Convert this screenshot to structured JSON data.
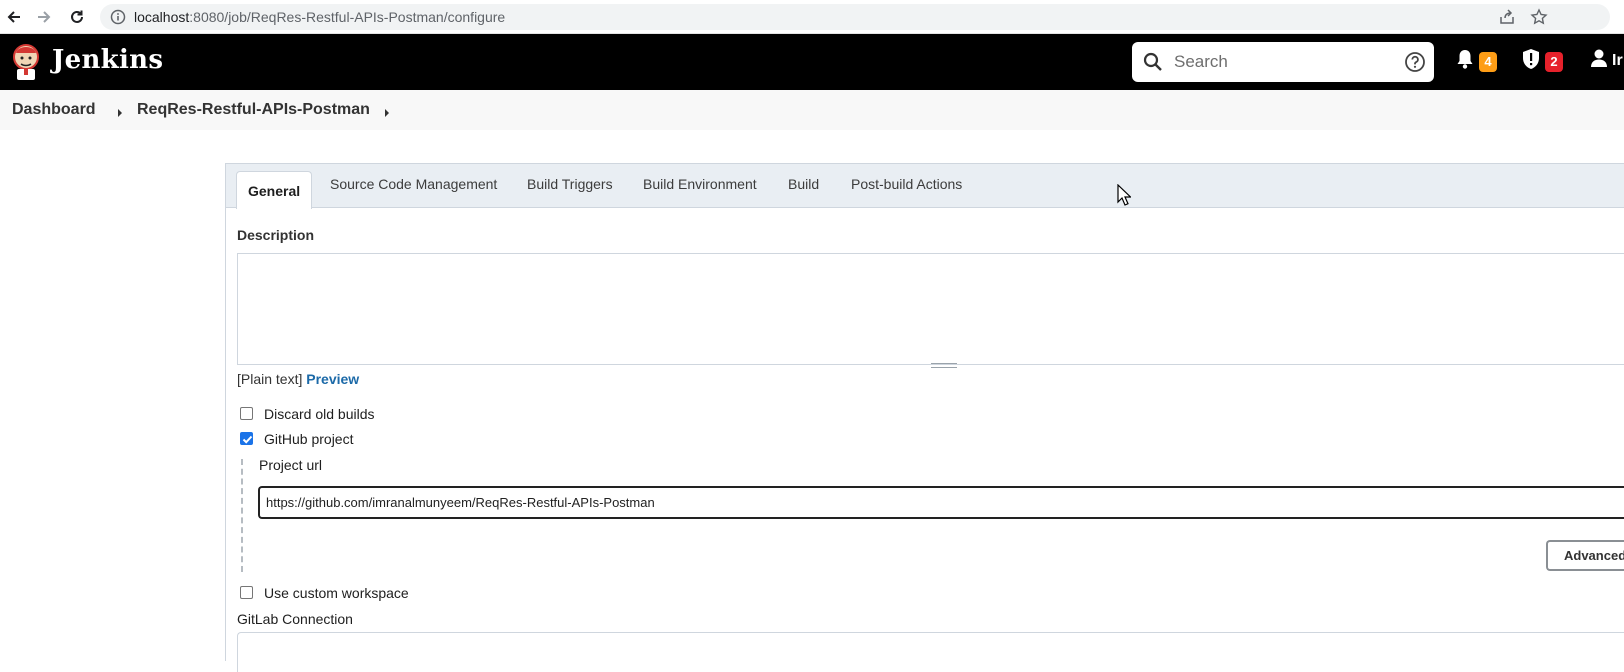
{
  "browser": {
    "url_host": "localhost",
    "url_rest": ":8080/job/ReqRes-Restful-APIs-Postman/configure"
  },
  "header": {
    "title": "Jenkins",
    "search_placeholder": "Search",
    "notifications_count": "4",
    "security_count": "2",
    "user_label": "Ir"
  },
  "breadcrumb": {
    "items": [
      "Dashboard",
      "ReqRes-Restful-APIs-Postman"
    ]
  },
  "tabs": [
    {
      "label": "General",
      "active": true
    },
    {
      "label": "Source Code Management"
    },
    {
      "label": "Build Triggers"
    },
    {
      "label": "Build Environment"
    },
    {
      "label": "Build"
    },
    {
      "label": "Post-build Actions"
    }
  ],
  "general": {
    "description_label": "Description",
    "description_value": "",
    "plain_text": "[Plain text]",
    "preview_link": "Preview",
    "discard_old_builds": {
      "label": "Discard old builds",
      "checked": false
    },
    "github_project": {
      "label": "GitHub project",
      "checked": true
    },
    "project_url_label": "Project url",
    "project_url_value": "https://github.com/imranalmunyeem/ReqRes-Restful-APIs-Postman",
    "advanced_button": "Advanced...",
    "custom_workspace": {
      "label": "Use custom workspace",
      "checked": false
    },
    "gitlab_connection_label": "GitLab Connection"
  },
  "colors": {
    "header_bg": "#000000",
    "notification_badge": "#fe9d16",
    "security_badge": "#e6212b",
    "link": "#1c6aa8",
    "checkbox_checked": "#1a73e8"
  }
}
